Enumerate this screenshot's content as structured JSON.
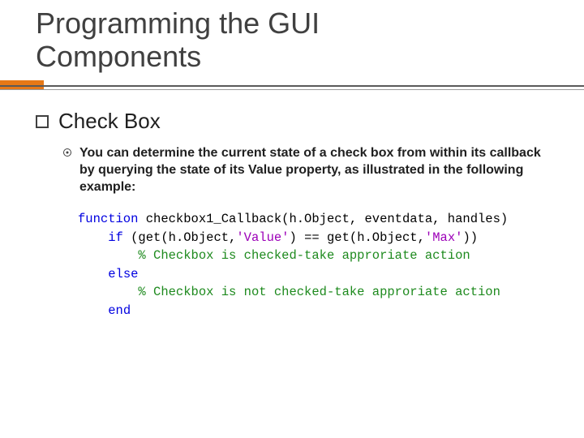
{
  "title_line1": "Programming the GUI",
  "title_line2": "Components",
  "section": "Check Box",
  "body": "You can determine the current state of a check box from within its callback by querying the state of its Value property, as illustrated in the following example:",
  "code": {
    "l1_kw": "function",
    "l1_rest": " checkbox1_Callback(h.Object, eventdata, handles)",
    "l2_indent": "    ",
    "l2_kw": "if",
    "l2_a": " (get(h.Object,",
    "l2_s1": "'Value'",
    "l2_b": ") == get(h.Object,",
    "l2_s2": "'Max'",
    "l2_c": "))",
    "l3_indent": "        ",
    "l3_cm": "% Checkbox is checked-take approriate action",
    "l4_indent": "    ",
    "l4_kw": "else",
    "l5_indent": "        ",
    "l5_cm": "% Checkbox is not checked-take approriate action",
    "l6_indent": "    ",
    "l6_kw": "end"
  }
}
